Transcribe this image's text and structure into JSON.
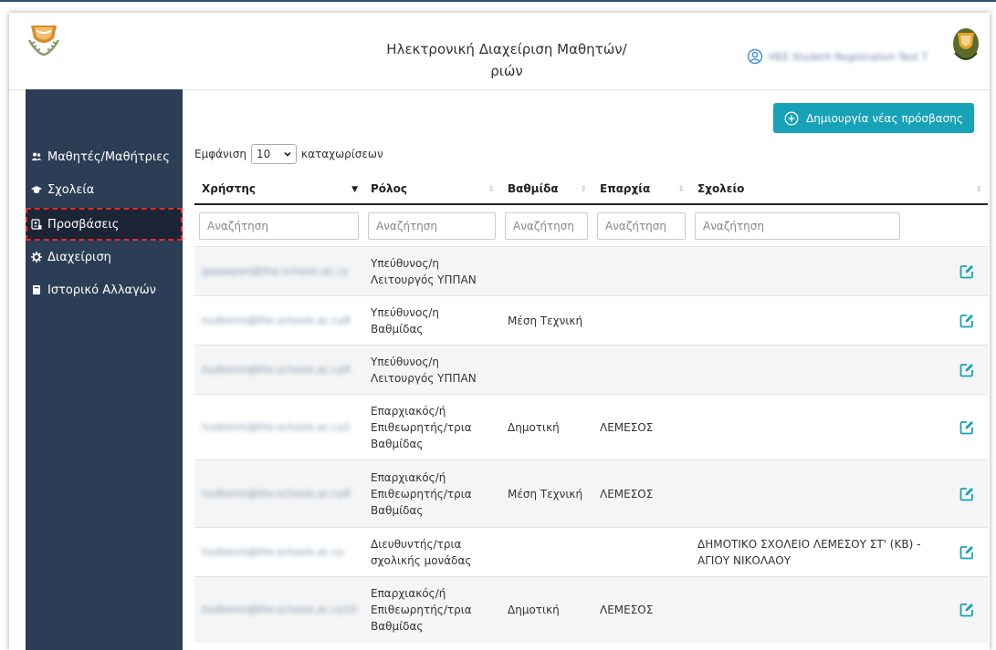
{
  "header": {
    "title_line1": "Ηλεκτρονική Διαχείριση Μαθητών/",
    "title_line2": "ριών",
    "user_name": "HEE Student Registration Test T"
  },
  "sidebar": {
    "items": [
      {
        "label": "Μαθητές/Μαθήτριες",
        "icon": "users-icon"
      },
      {
        "label": "Σχολεία",
        "icon": "graduation-cap-icon"
      },
      {
        "label": "Προσβάσεις",
        "icon": "id-card-icon",
        "active": true
      },
      {
        "label": "Διαχείριση",
        "icon": "gear-icon"
      },
      {
        "label": "Ιστορικό Αλλαγών",
        "icon": "book-icon"
      }
    ]
  },
  "toolbar": {
    "create_label": "Δημιουργία νέας πρόσβασης"
  },
  "length_menu": {
    "prefix": "Εμφάνιση",
    "value": "10",
    "suffix": "καταχωρίσεων"
  },
  "table": {
    "headers": [
      "Χρήστης",
      "Ρόλος",
      "Βαθμίδα",
      "Επαρχία",
      "Σχολείο"
    ],
    "search_placeholder": "Αναζήτηση",
    "rows": [
      {
        "user": "gaaaepan@tha.schools.ac.cy",
        "role": [
          "Υπεύθυνος/η",
          "Λειτουργός ΥΠΠΑΝ"
        ],
        "level": "",
        "district": "",
        "school": ""
      },
      {
        "user": "hudtenm@the.schools.ac.cy8",
        "role": [
          "Υπεύθυνος/η",
          "Βαθμίδας"
        ],
        "level": "Μέση Τεχνική",
        "district": "",
        "school": ""
      },
      {
        "user": "hudtenm@the.schools.ac.cy9",
        "role": [
          "Υπεύθυνος/η",
          "Λειτουργός ΥΠΠΑΝ"
        ],
        "level": "",
        "district": "",
        "school": ""
      },
      {
        "user": "hudtenm@the.schools.ac.cy2",
        "role": [
          "Επαρχιακός/ή",
          "Επιθεωρητής/τρια",
          "Βαθμίδας"
        ],
        "level": "Δημοτική",
        "district": "ΛΕΜΕΣΟΣ",
        "school": ""
      },
      {
        "user": "hudtenm@the.schools.ac.cy8",
        "role": [
          "Επαρχιακός/ή",
          "Επιθεωρητής/τρια",
          "Βαθμίδας"
        ],
        "level": "Μέση Τεχνική",
        "district": "ΛΕΜΕΣΟΣ",
        "school": ""
      },
      {
        "user": "hudtenm@the.schools.ac.cy",
        "role": [
          "Διευθυντής/τρια",
          "σχολικής μονάδας"
        ],
        "level": "",
        "district": "",
        "school": [
          "ΔΗΜΟΤΙΚΟ ΣΧΟΛΕΙΟ ΛΕΜΕΣΟΥ ΣΤ' (ΚΒ) -",
          "ΑΓΙΟΥ ΝΙΚΟΛΑΟΥ"
        ]
      },
      {
        "user": "hudtenm@the.schools.ac.cy10",
        "role": [
          "Επαρχιακός/ή",
          "Επιθεωρητής/τρια",
          "Βαθμίδας"
        ],
        "level": "Δημοτική",
        "district": "ΛΕΜΕΣΟΣ",
        "school": ""
      }
    ]
  },
  "colors": {
    "sidebar": "#2c3e55",
    "sidebar_active": "#1c2535",
    "accent": "#17a2b8",
    "edit_icon": "#17a2b8"
  }
}
